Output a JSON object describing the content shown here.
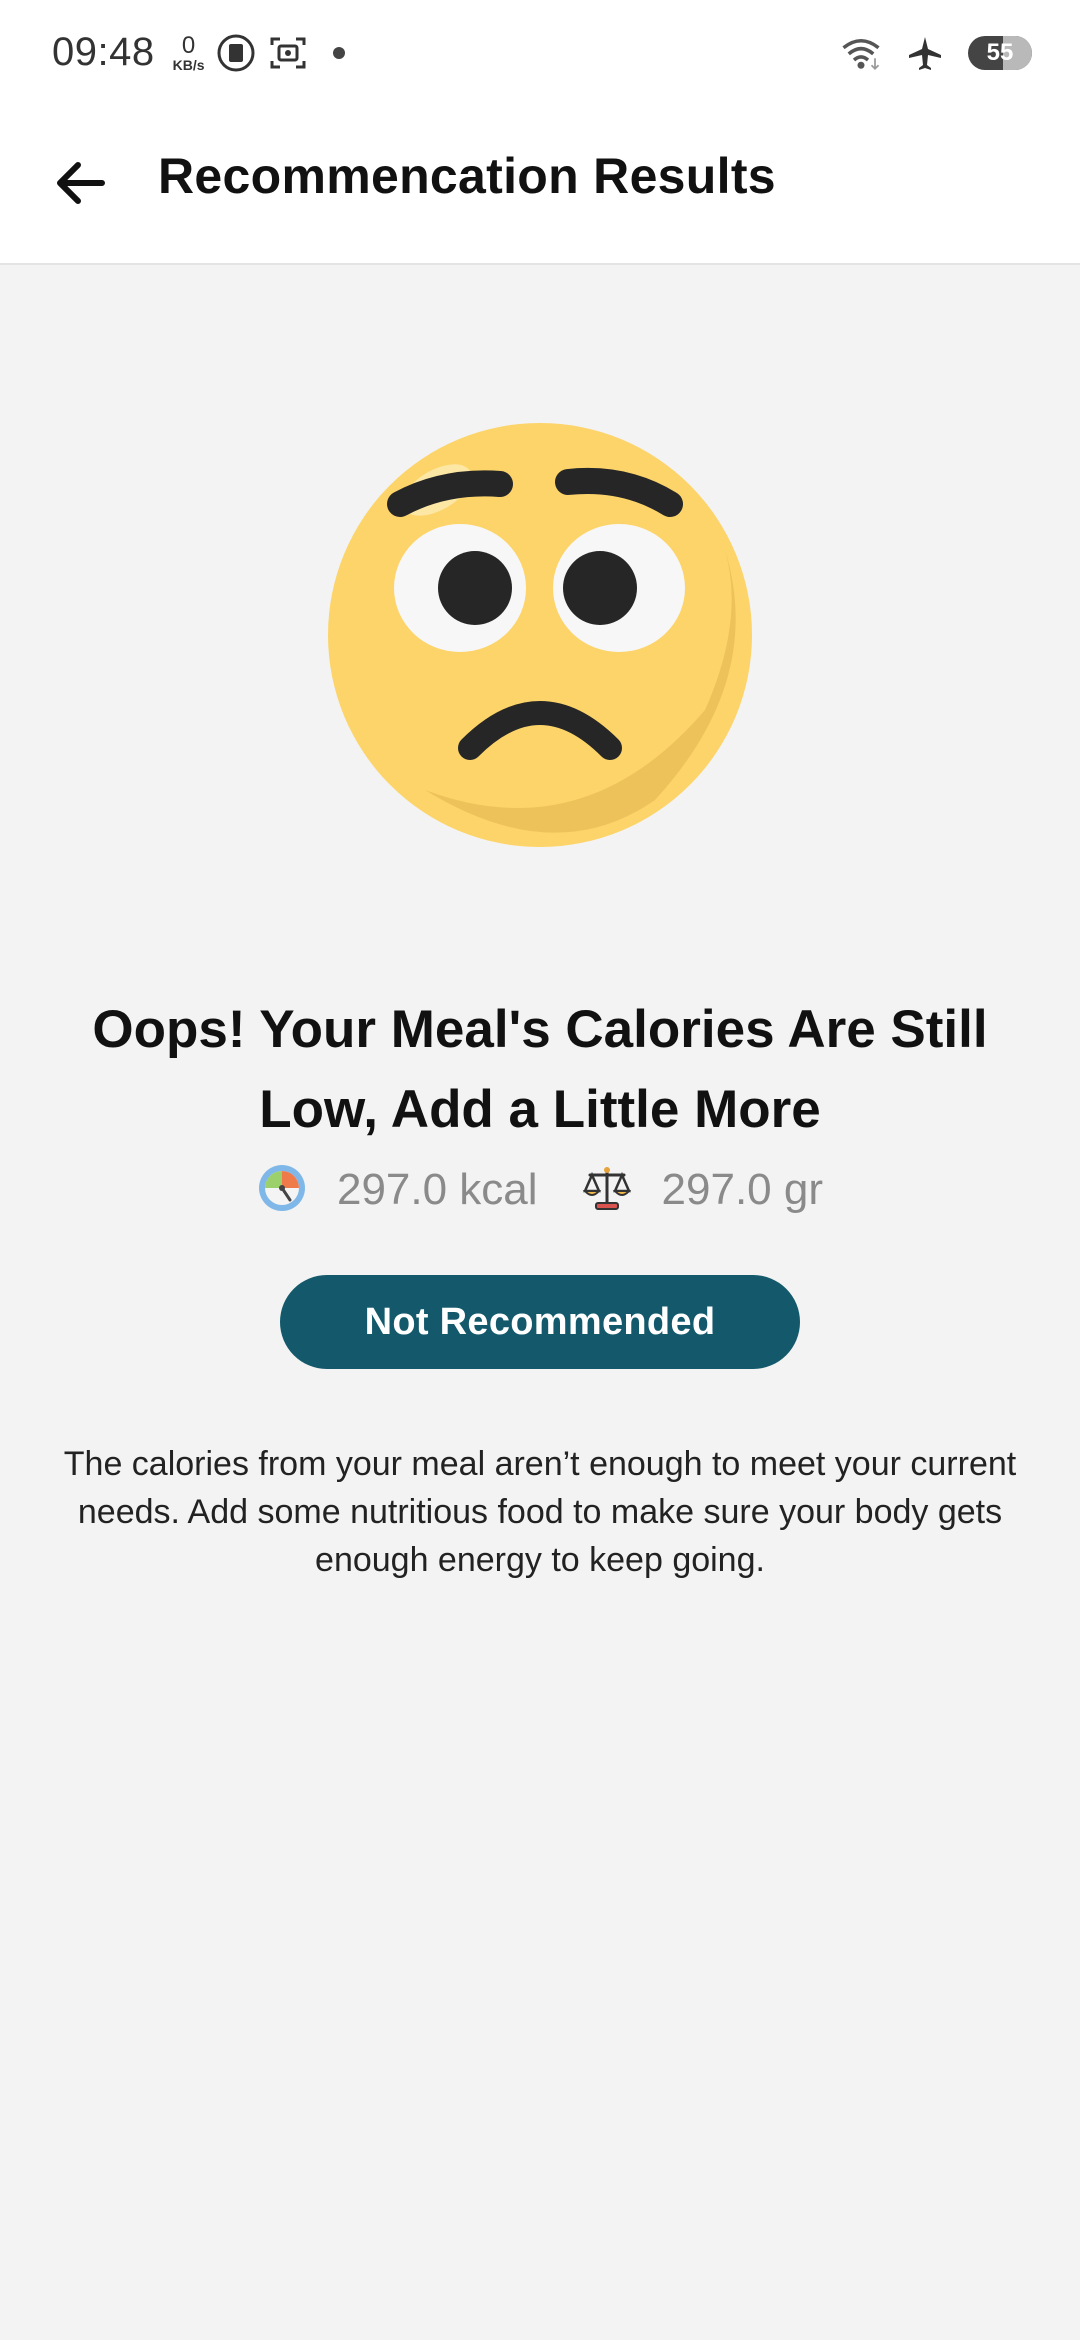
{
  "status_bar": {
    "time": "09:48",
    "net_speed_value": "0",
    "net_speed_unit": "KB/s",
    "battery_level": "55"
  },
  "app_bar": {
    "title": "Recommencation Results"
  },
  "result": {
    "headline": "Oops! Your Meal's Calories Are Still Low, Add a Little More",
    "calories": "297.0 kcal",
    "weight": "297.0 gr",
    "status_label": "Not Recommended",
    "description": "The calories from your meal aren’t enough to meet your current needs. Add some nutritious food to make sure your body gets enough energy to keep going."
  },
  "colors": {
    "accent": "#13596b",
    "emoji_face": "#fcd46a",
    "background": "#f3f3f3"
  },
  "icons": {
    "back": "arrow-left-icon",
    "emoji": "worried-face-icon",
    "calories": "speedometer-icon",
    "weight": "scale-icon"
  }
}
